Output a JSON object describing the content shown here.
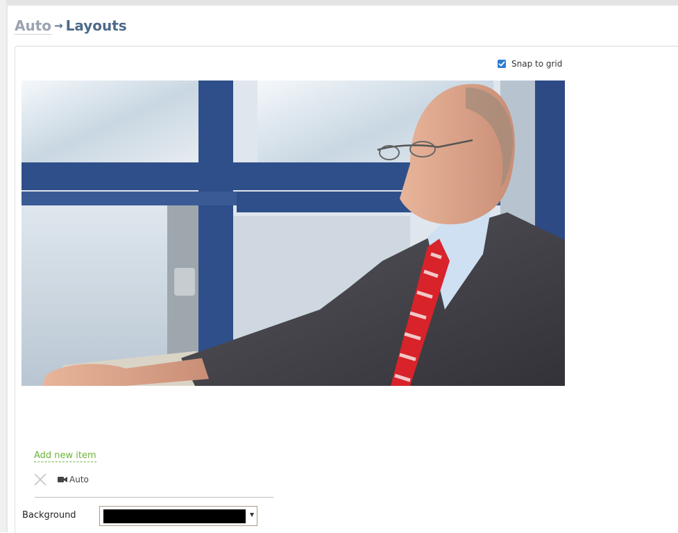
{
  "breadcrumb": {
    "parent": "Auto",
    "separator": "→",
    "current": "Layouts"
  },
  "layout_editor": {
    "snap_to_grid": {
      "label": "Snap to grid",
      "checked": true
    },
    "canvas": {
      "content": "live video source",
      "source": "Auto"
    },
    "add_item_label": "Add new item",
    "items": [
      {
        "icon": "video-camera-icon",
        "label": "Auto"
      }
    ],
    "background": {
      "label": "Background",
      "value_color": "#000000"
    }
  },
  "colors": {
    "accent_link": "#6bb33a",
    "breadcrumb_current": "#4d6a8a",
    "breadcrumb_parent": "#9aa3b0",
    "checkbox": "#2e7bd1"
  }
}
